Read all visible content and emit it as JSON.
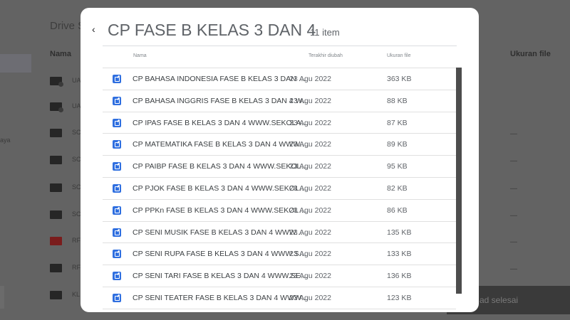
{
  "background": {
    "title": "Drive S",
    "col_name": "Nama",
    "col_size": "Ukuran file",
    "side_text": "aya",
    "rows": [
      {
        "letters": "UA",
        "type": "shared"
      },
      {
        "letters": "UA",
        "type": "shared"
      },
      {
        "letters": "SC",
        "type": "folder"
      },
      {
        "letters": "SC",
        "type": "folder"
      },
      {
        "letters": "SC",
        "type": "folder"
      },
      {
        "letters": "SC",
        "type": "folder"
      },
      {
        "letters": "RF",
        "type": "red"
      },
      {
        "letters": "RF",
        "type": "folder"
      },
      {
        "letters": "KL",
        "type": "folder"
      }
    ],
    "dash": "—",
    "toast": "ad selesai"
  },
  "dialog": {
    "back_icon": "chevron-left-icon",
    "title": "CP FASE B KELAS 3 DAN 4",
    "count": "11 item",
    "columns": {
      "name": "Nama",
      "modified": "Terakhir diubah",
      "size": "Ukuran file"
    },
    "files": [
      {
        "name": "CP BAHASA INDONESIA FASE B KELAS 3 DAN 4 ...",
        "modified": "23 Agu 2022",
        "size": "363 KB"
      },
      {
        "name": "CP BAHASA INGGRIS FASE B KELAS 3 DAN 4 W...",
        "modified": "23 Agu 2022",
        "size": "88 KB"
      },
      {
        "name": "CP IPAS FASE B KELAS 3 DAN 4 WWW.SEKOLAH...",
        "modified": "23 Agu 2022",
        "size": "87 KB"
      },
      {
        "name": "CP MATEMATIKA FASE B KELAS 3 DAN 4 WWW.S...",
        "modified": "23 Agu 2022",
        "size": "89 KB"
      },
      {
        "name": "CP PAIBP FASE B KELAS 3 DAN 4 WWW.SEKOLA...",
        "modified": "23 Agu 2022",
        "size": "95 KB"
      },
      {
        "name": "CP PJOK FASE B KELAS 3 DAN 4 WWW.SEKOLA...",
        "modified": "23 Agu 2022",
        "size": "82 KB"
      },
      {
        "name": "CP PPKn FASE B KELAS 3 DAN 4 WWW.SEKOLA...",
        "modified": "23 Agu 2022",
        "size": "86 KB"
      },
      {
        "name": "CP SENI MUSIK FASE B KELAS 3 DAN 4 WWW.SE...",
        "modified": "23 Agu 2022",
        "size": "135 KB"
      },
      {
        "name": "CP SENI RUPA FASE B KELAS 3 DAN 4 WWW.SEK...",
        "modified": "23 Agu 2022",
        "size": "133 KB"
      },
      {
        "name": "CP SENI TARI FASE B KELAS 3 DAN 4 WWW.SEKO...",
        "modified": "23 Agu 2022",
        "size": "136 KB"
      },
      {
        "name": "CP SENI TEATER FASE B KELAS 3 DAN 4 WWW.SE...",
        "modified": "23 Agu 2022",
        "size": "123 KB"
      }
    ],
    "file_icon": "document-edit-icon",
    "accent": "#2f6fe0"
  }
}
